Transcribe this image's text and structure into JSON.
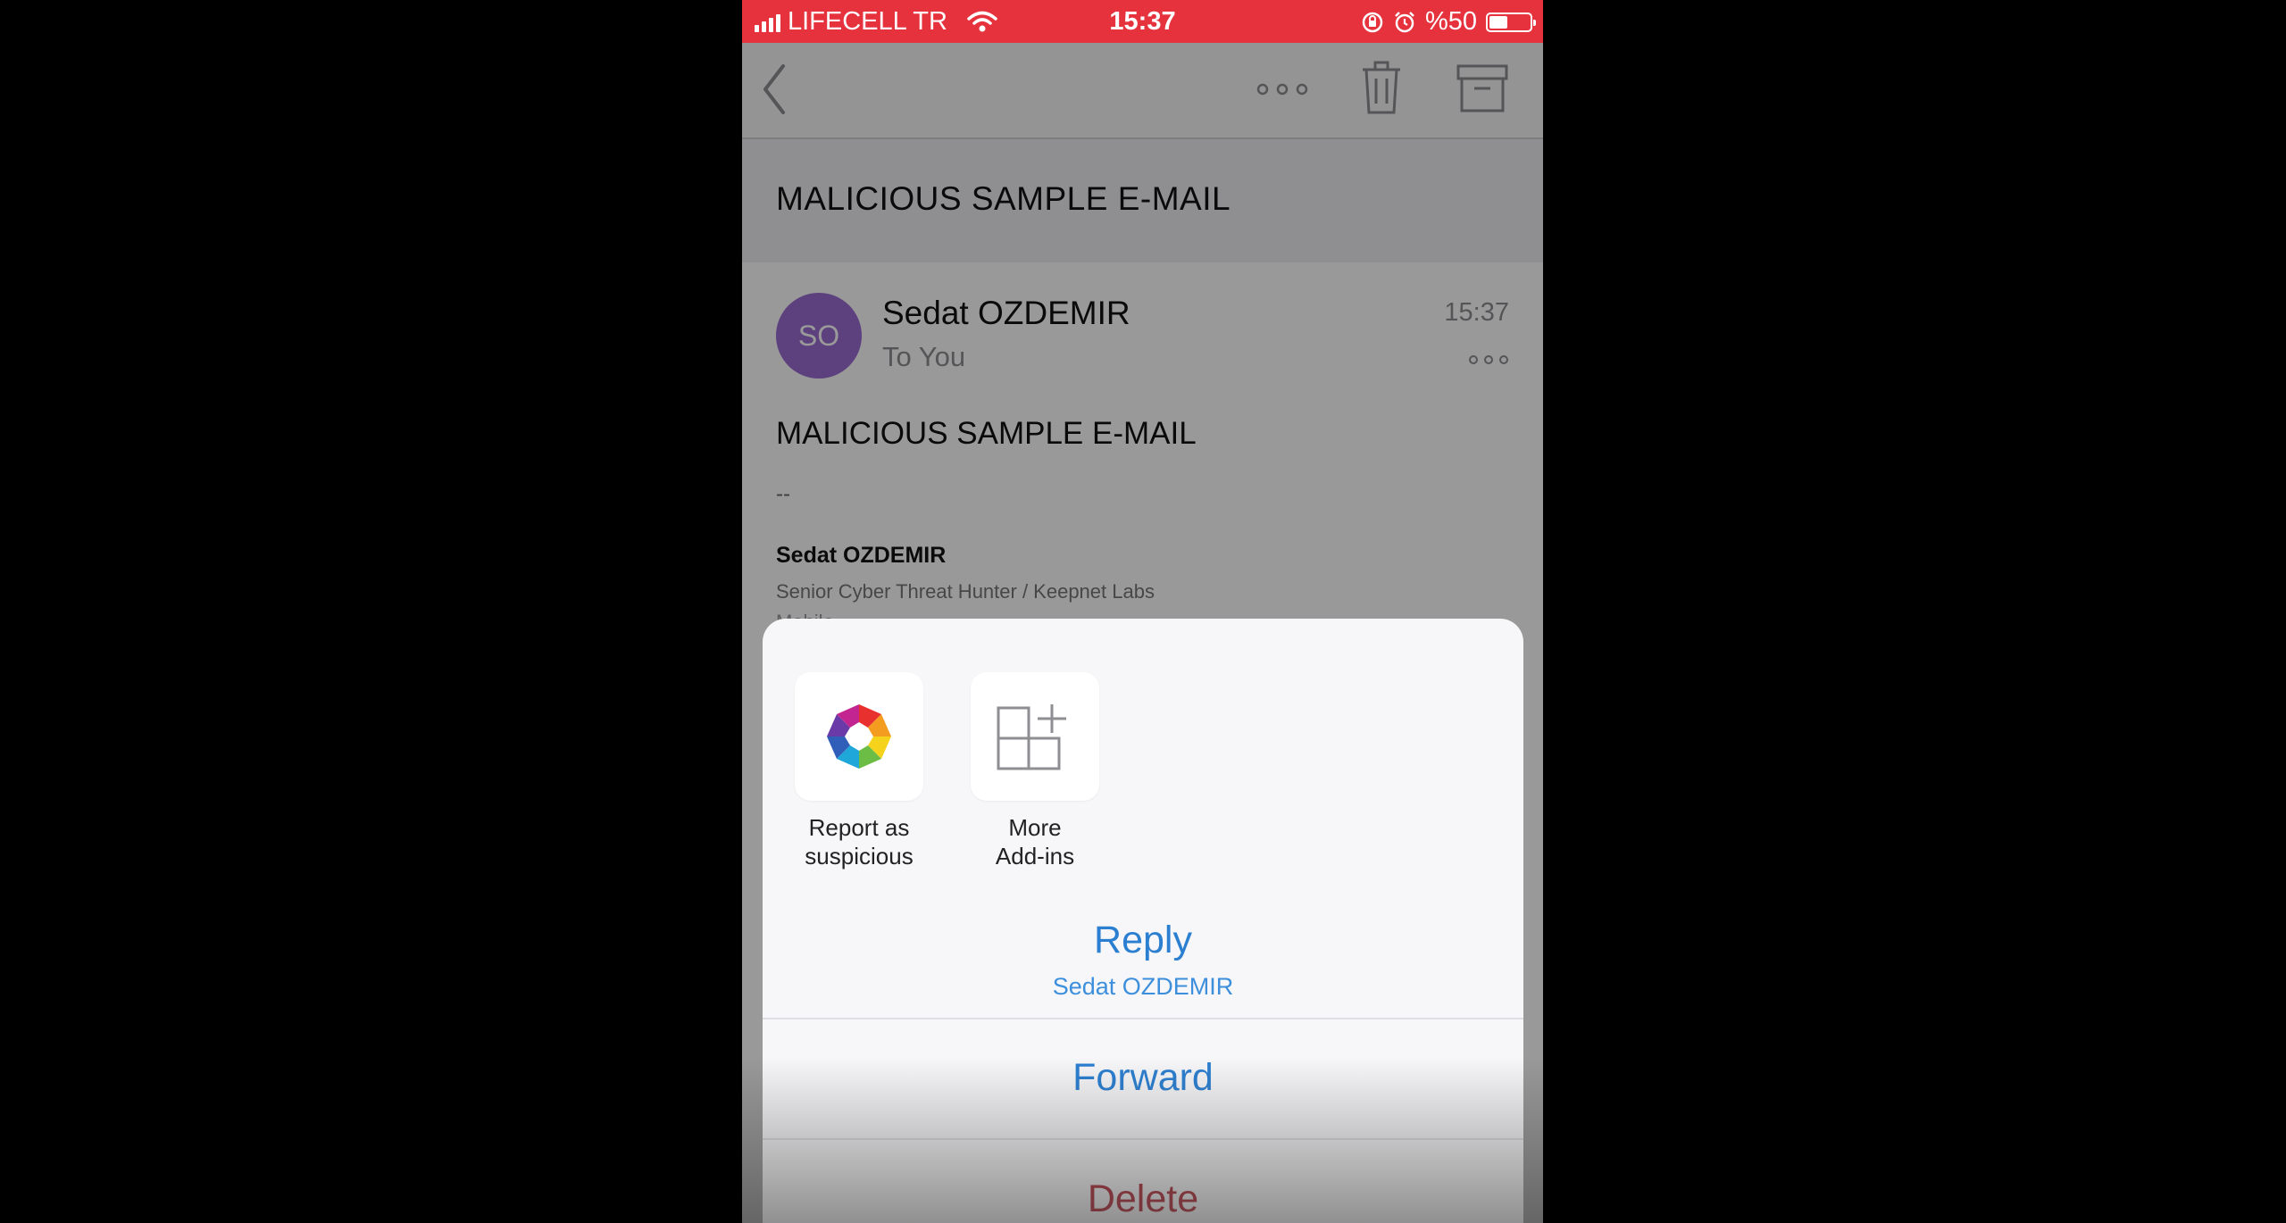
{
  "status_bar": {
    "carrier": "LIFECELL TR",
    "time": "15:37",
    "battery_text": "%50",
    "battery_level": 0.5,
    "color": "#e5323c",
    "icons": [
      "signal-icon",
      "wifi-icon",
      "rotation-lock-icon",
      "alarm-icon",
      "battery-icon"
    ]
  },
  "toolbar": {
    "icons": [
      "back-chevron-icon",
      "more-options-icon",
      "trash-icon",
      "archive-icon"
    ]
  },
  "email": {
    "subject": "MALICIOUS SAMPLE E-MAIL",
    "sender": {
      "initials": "SO",
      "name": "Sedat OZDEMIR",
      "avatar_color": "#9b6bd2"
    },
    "recipient": "To You",
    "time": "15:37",
    "body_subject": "MALICIOUS SAMPLE E-MAIL",
    "separator": "--",
    "signature": {
      "name": "Sedat OZDEMIR",
      "title": "Senior Cyber Threat Hunter / Keepnet Labs",
      "extra": "Mobile"
    }
  },
  "action_sheet": {
    "addins": [
      {
        "label_line1": "Report as",
        "label_line2": "suspicious",
        "icon": "keepnet-logo-icon"
      },
      {
        "label_line1": "More",
        "label_line2": "Add-ins",
        "icon": "add-ins-grid-icon"
      }
    ],
    "reply": {
      "label": "Reply",
      "sub": "Sedat OZDEMIR"
    },
    "forward": {
      "label": "Forward"
    },
    "delete": {
      "label": "Delete"
    },
    "accent_color": "#2b7fd1",
    "destructive_color": "#b2313b"
  }
}
